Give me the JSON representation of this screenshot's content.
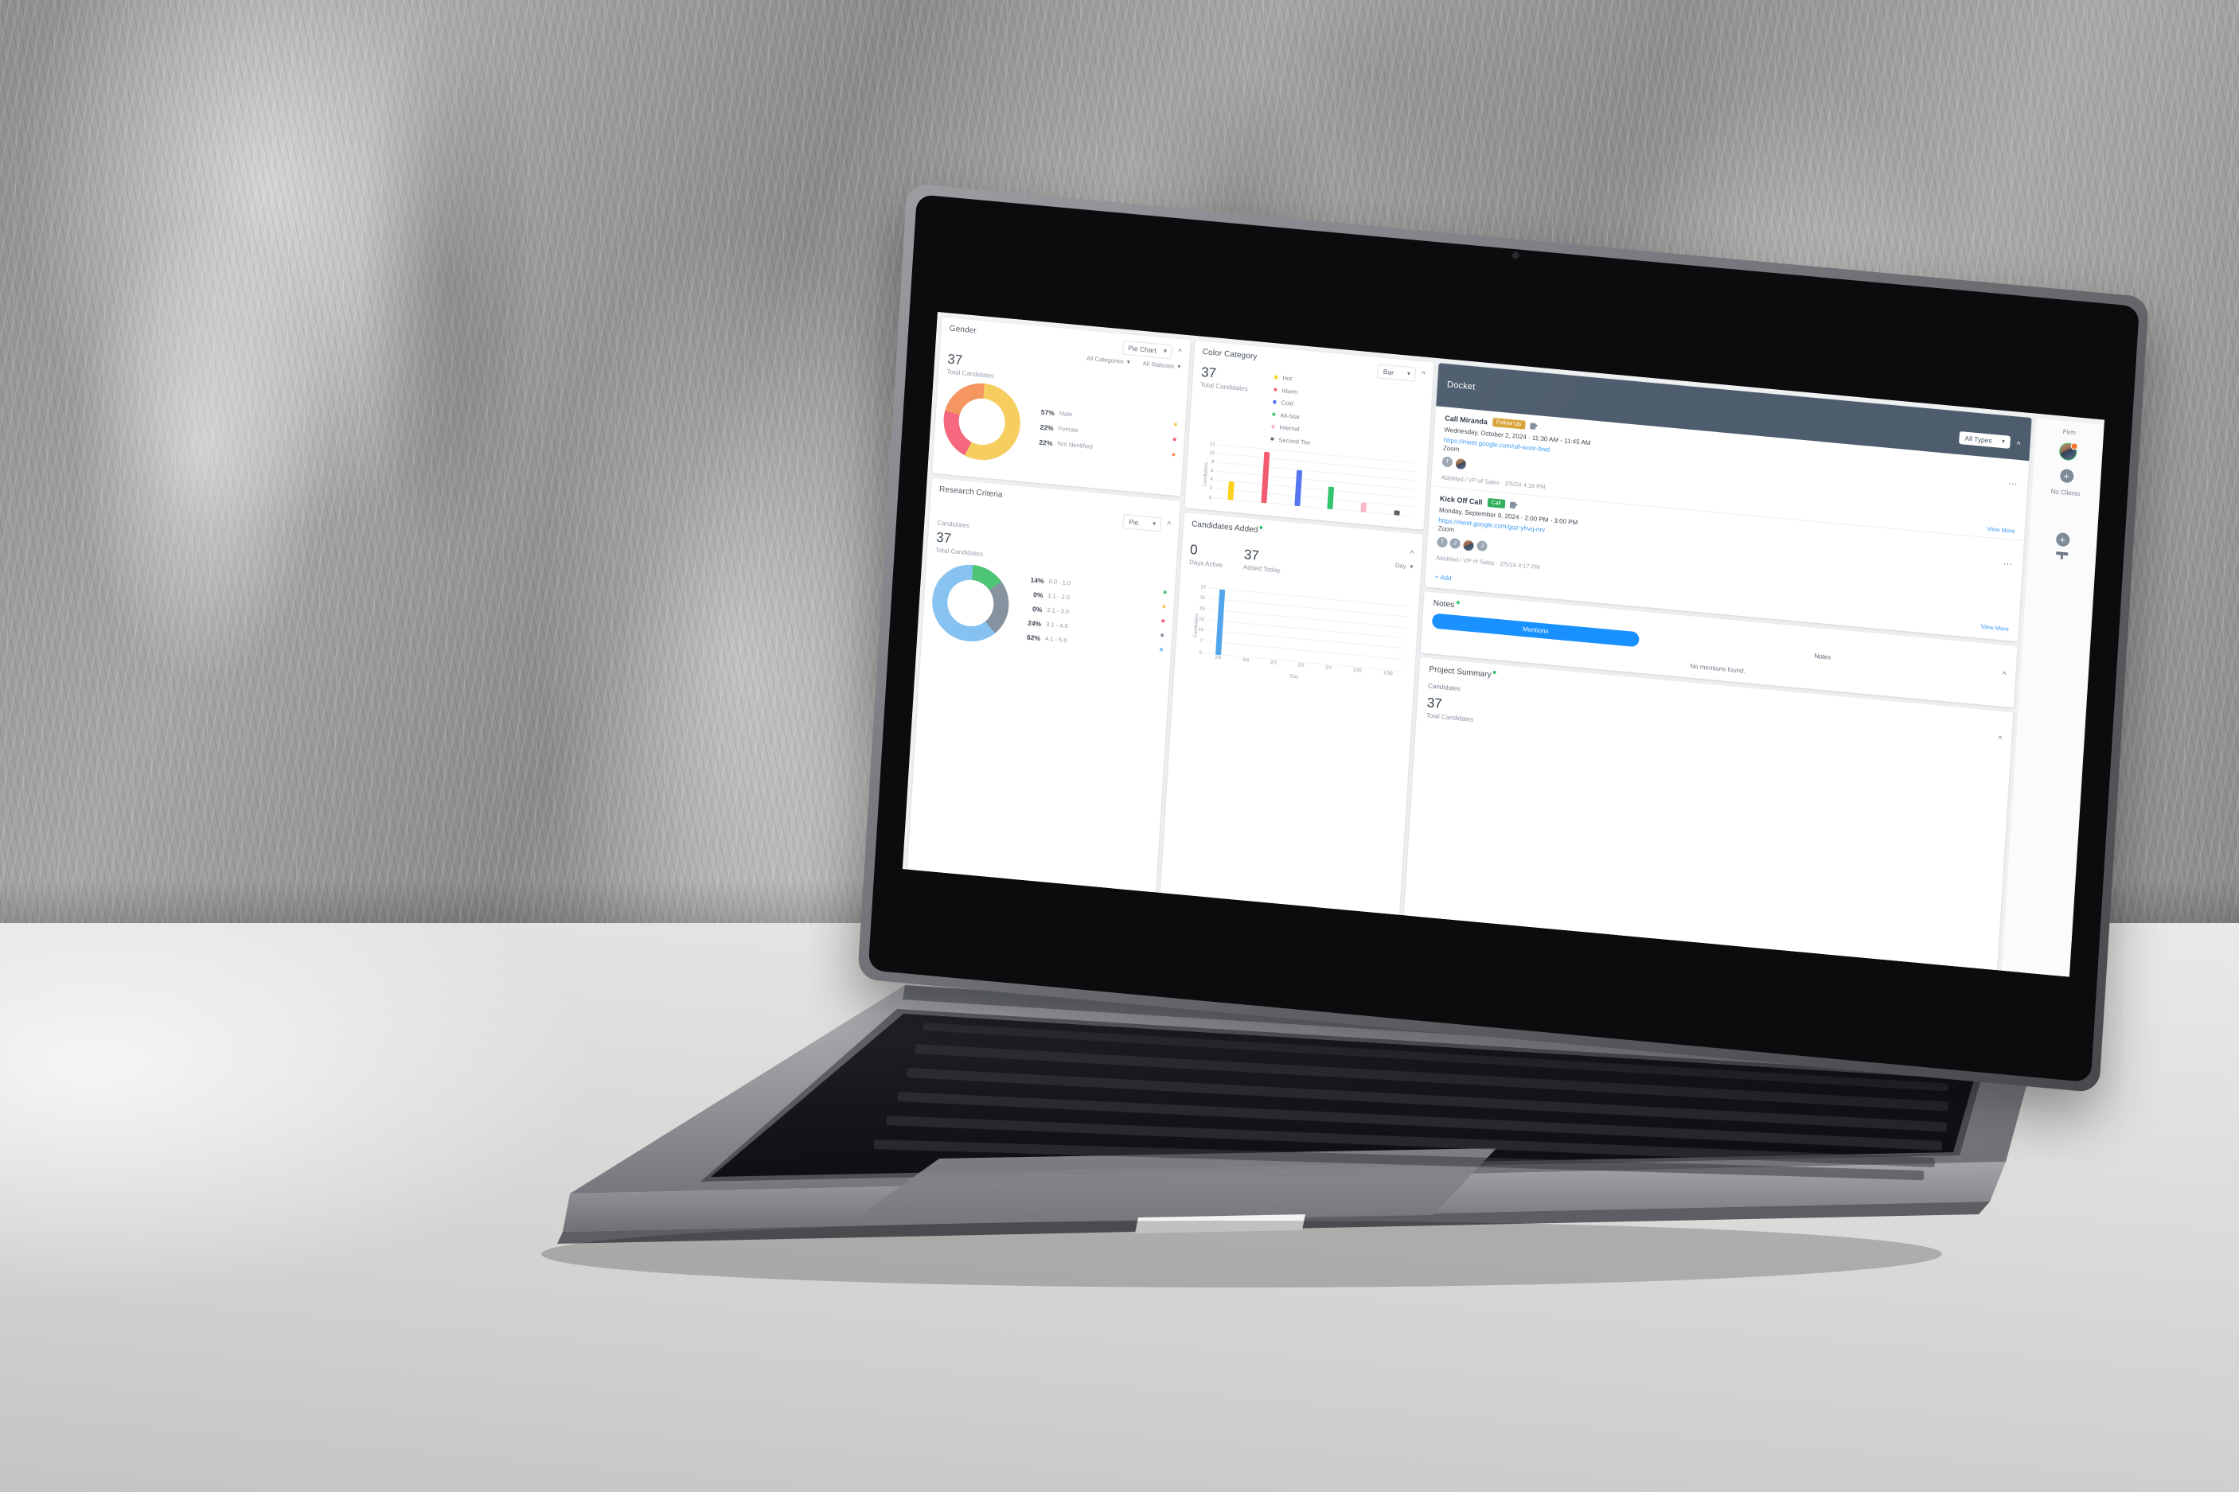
{
  "gender_card": {
    "title": "Gender",
    "chart_type_label": "Pie Chart",
    "collapse_icon": "chevron-up-icon",
    "filters": [
      {
        "label": "All Categories"
      },
      {
        "label": "All Statuses"
      }
    ],
    "total": "37",
    "total_label": "Total Candidates"
  },
  "color_card": {
    "title": "Color Category",
    "chart_type_label": "Bar",
    "total": "37",
    "total_label": "Total Candidates"
  },
  "research_card": {
    "title": "Research Criteria",
    "chart_type_label": "Pie",
    "section_label": "Candidates",
    "total": "37",
    "total_label": "Total Candidates"
  },
  "added_card": {
    "title": "Candidates Added",
    "days_active": "0",
    "days_active_label": "Days Active",
    "added_today": "37",
    "added_today_label": "Added Today",
    "period_label": "Day"
  },
  "docket": {
    "title": "Docket",
    "type_filter_label": "All Types",
    "add_label": "+ Add",
    "view_more_label": "View More",
    "events": [
      {
        "title": "Call Miranda",
        "tag": "Follow Up",
        "tag_color": "#d7a43a",
        "when": "Wednesday, October 2, 2024  ·  11:30 AM  -  11:45 AM",
        "link": "https://meet.google.com/uif-wonr-bwd",
        "location": "Zoom",
        "avatars": [
          "T",
          ""
        ],
        "meta": "AbbMed / VP of Sales · 2/5/24   4:18 PM"
      },
      {
        "title": "Kick Off Call",
        "tag": "Call",
        "tag_color": "#2fae58",
        "when": "Monday, September 9, 2024  ·  2:00 PM  -  3:00 PM",
        "link": "https://meet.google.com/gqz-yhvq-nrv",
        "location": "Zoom",
        "avatars": [
          "T",
          "J",
          "",
          "J"
        ],
        "meta": "AbbMed / VP of Sales · 2/5/24   4:17 PM"
      }
    ]
  },
  "notes_card": {
    "title": "Notes",
    "tab_active": "Mentions",
    "tab_other": "Notes",
    "empty_message": "No mentions found."
  },
  "project_summary": {
    "title": "Project Summary",
    "section_label": "Candidates",
    "total": "37",
    "total_label": "Total Candidates"
  },
  "rail": {
    "firm_label": "Firm",
    "no_clients_label": "No Clients",
    "add_icon": "plus-circle-icon",
    "lamp_icon": "desk-lamp-icon"
  },
  "chart_data": [
    {
      "type": "pie",
      "title": "Gender",
      "labels": [
        "Male",
        "Female",
        "Not Identified"
      ],
      "values": [
        57,
        22,
        22
      ],
      "display_values": [
        "57%",
        "22%",
        "22%"
      ],
      "colors": [
        "#f5c84e",
        "#f4566f",
        "#f4894e"
      ],
      "legend": "right",
      "donut": true
    },
    {
      "type": "bar",
      "title": "Color Category",
      "categories": [
        "Hot",
        "Warm",
        "Cold",
        "All-Star",
        "Internal",
        "Second Tier"
      ],
      "values": [
        4,
        11.5,
        8,
        5,
        2,
        1
      ],
      "colors": [
        "#fcd117",
        "#f3566c",
        "#5271f0",
        "#2ec26a",
        "#f9b9c4",
        "#5a5f66"
      ],
      "ylabel": "Candidates",
      "xlabel": "",
      "yticks": [
        0,
        2,
        4,
        6,
        8,
        10,
        12
      ],
      "ylim": [
        0,
        13
      ],
      "grid": true,
      "legend": "top-right"
    },
    {
      "type": "pie",
      "title": "Research Criteria",
      "labels": [
        "0.0 - 1.0",
        "1.1 - 2.0",
        "2.1 - 3.0",
        "3.1 - 4.0",
        "4.1 - 5.0"
      ],
      "values": [
        14,
        0,
        0,
        24,
        62
      ],
      "display_values": [
        "14%",
        "0%",
        "0%",
        "24%",
        "62%"
      ],
      "colors": [
        "#3ec06a",
        "#f5c84e",
        "#f4566f",
        "#7e8a99",
        "#7cbdf0"
      ],
      "legend": "right",
      "donut": true
    },
    {
      "type": "bar",
      "title": "Candidates Added",
      "categories": [
        "2/5",
        "2/4",
        "2/3",
        "2/2",
        "2/1",
        "1/31",
        "1/30"
      ],
      "values": [
        37,
        0,
        0,
        0,
        0,
        0,
        0
      ],
      "colors": [
        "#4da3ea"
      ],
      "ylabel": "Candidates",
      "xlabel": "Day",
      "yticks": [
        0,
        7,
        13,
        19,
        25,
        31,
        37
      ],
      "ylim": [
        0,
        37
      ],
      "grid": true
    }
  ]
}
